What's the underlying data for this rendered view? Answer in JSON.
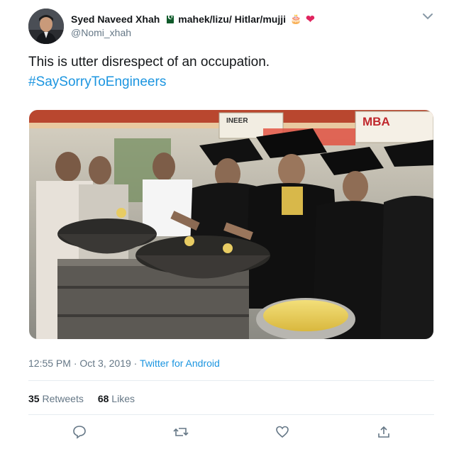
{
  "author": {
    "display_name": "Syed Naveed Xhah",
    "name_suffix": "mahek/lizu/ Hitlar/mujji",
    "handle": "@Nomi_xhah",
    "heart_emoji": "❤",
    "cake_emoji": "🎂"
  },
  "tweet": {
    "text": "This is utter disrespect of an occupation.",
    "hashtag": "#SaySorryToEngineers"
  },
  "photo": {
    "signs": [
      "INEER",
      "MBA"
    ]
  },
  "meta": {
    "time": "12:55 PM",
    "separator": " · ",
    "date": "Oct 3, 2019",
    "source": "Twitter for Android"
  },
  "stats": {
    "retweets_count": "35",
    "retweets_label": "Retweets",
    "likes_count": "68",
    "likes_label": "Likes"
  },
  "colors": {
    "link": "#1b95e0",
    "secondary_text": "#657786",
    "primary_text": "#14171a",
    "divider": "#e6ecf0"
  }
}
